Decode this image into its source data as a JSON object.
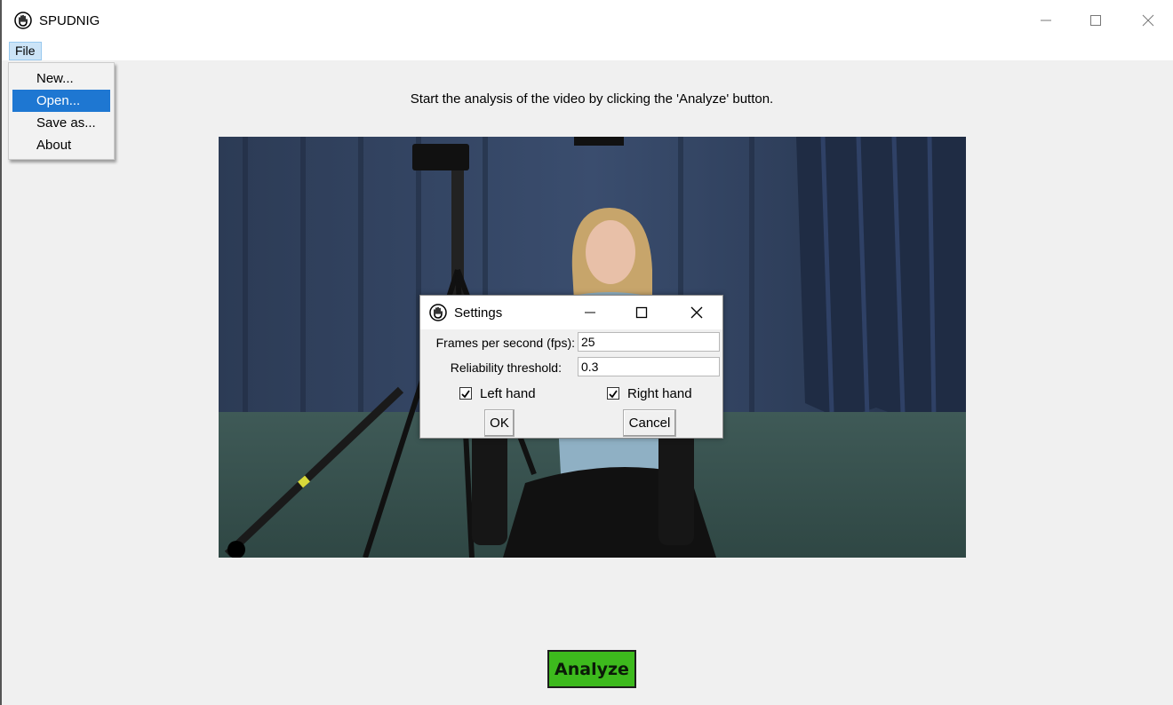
{
  "app": {
    "title": "SPUDNIG",
    "icon": "hand-icon"
  },
  "window_controls": {
    "minimize": "minimize-icon",
    "maximize": "maximize-icon",
    "close": "close-icon"
  },
  "menubar": {
    "file_label": "File"
  },
  "file_menu": {
    "items": [
      {
        "label": "New..."
      },
      {
        "label": "Open...",
        "highlighted": true
      },
      {
        "label": "Save as..."
      },
      {
        "label": "About"
      }
    ]
  },
  "main": {
    "instruction": "Start the analysis of the video by clicking the 'Analyze' button.",
    "analyze_label": "Analyze",
    "analyze_color": "#3dba1d"
  },
  "settings_dialog": {
    "title": "Settings",
    "fps_label": "Frames per second (fps):",
    "fps_value": "25",
    "threshold_label": "Reliability threshold:",
    "threshold_value": "0.3",
    "left_hand_label": "Left hand",
    "left_hand_checked": true,
    "right_hand_label": "Right hand",
    "right_hand_checked": true,
    "ok_label": "OK",
    "cancel_label": "Cancel"
  },
  "colors": {
    "menu_highlight": "#1e77d2",
    "window_bg": "#f0f0f0"
  }
}
